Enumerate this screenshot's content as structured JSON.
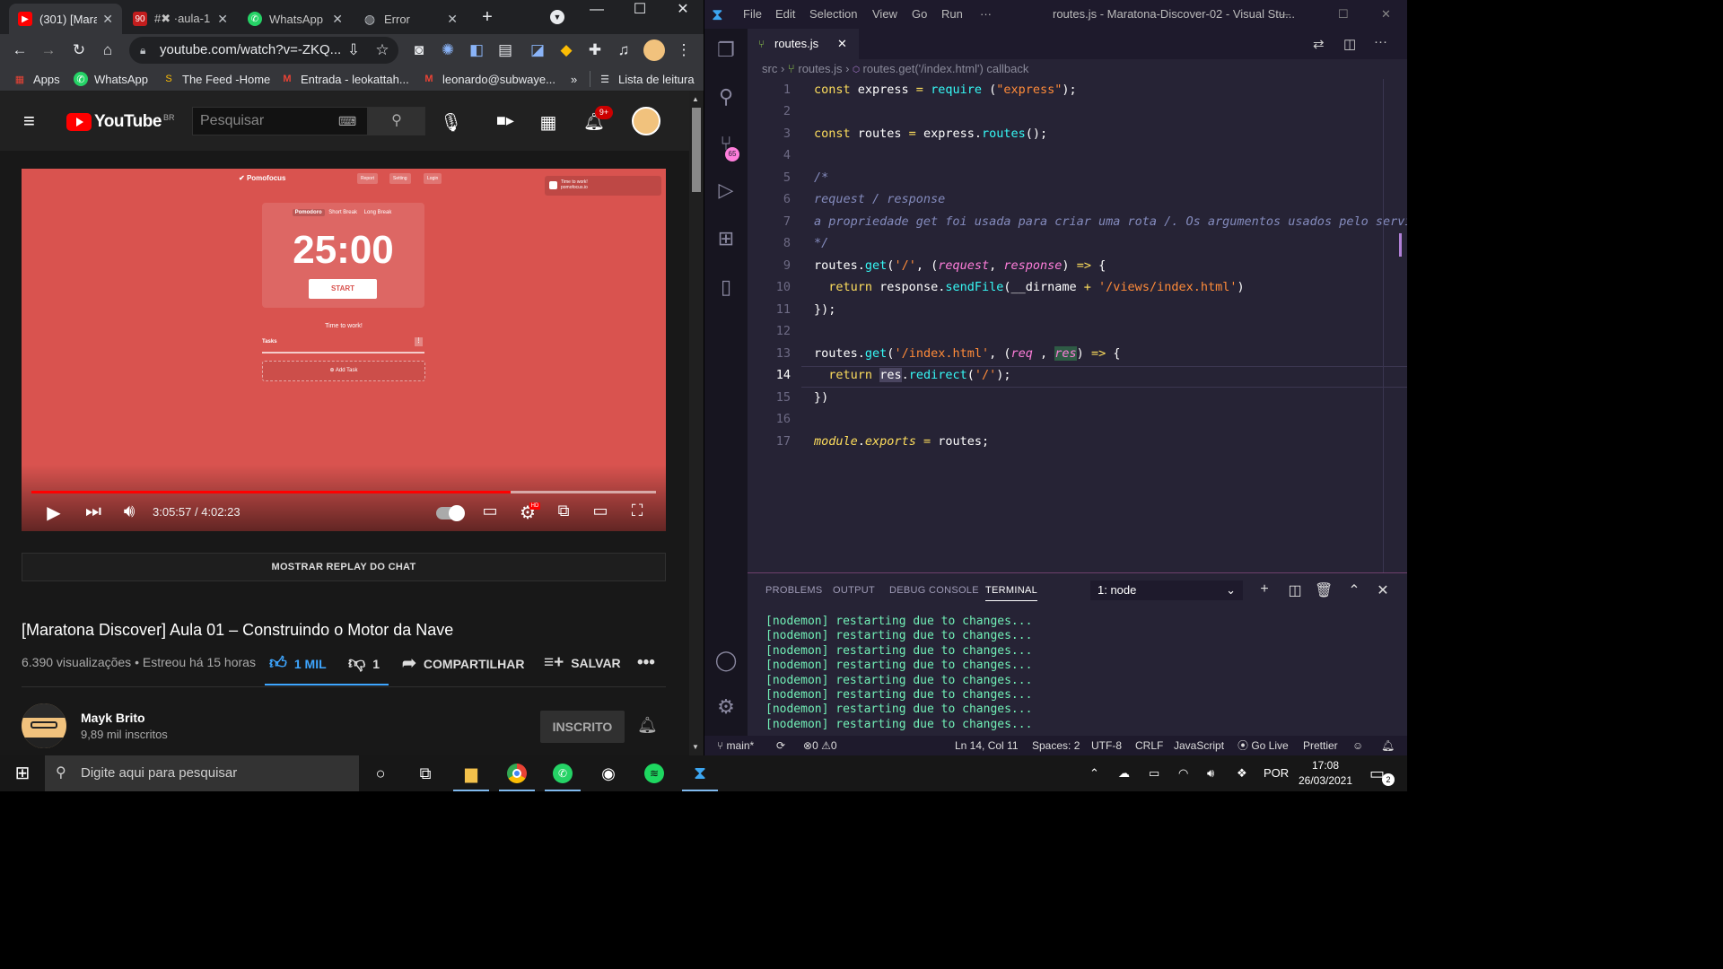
{
  "chrome": {
    "tabs": [
      {
        "title": "(301) [Mara",
        "favicon": "youtube-icon",
        "active": true
      },
      {
        "title": "#✖ ·aula-1",
        "favicon": "discord-icon",
        "active": false
      },
      {
        "title": "WhatsApp",
        "favicon": "whatsapp-icon",
        "active": false
      },
      {
        "title": "Error",
        "favicon": "globe-icon",
        "active": false
      }
    ],
    "new_tab": "+",
    "url": "youtube.com/watch?v=-ZKQ...",
    "bookmarks": [
      {
        "label": "Apps",
        "icon": "apps-grid-icon"
      },
      {
        "label": "WhatsApp",
        "icon": "whatsapp-icon"
      },
      {
        "label": "The Feed -Home",
        "icon": "feed-icon"
      },
      {
        "label": "Entrada - leokattah...",
        "icon": "gmail-icon"
      },
      {
        "label": "leonardo@subwaye...",
        "icon": "gmail-icon"
      }
    ],
    "bookmarks_overflow": "»",
    "reading_list": "Lista de leitura"
  },
  "youtube": {
    "logo_text": "YouTube",
    "country": "BR",
    "search_placeholder": "Pesquisar",
    "notification_badge": "9+",
    "video": {
      "app_logo": "Pomofocus",
      "top_buttons": [
        "Report",
        "Setting",
        "Login"
      ],
      "notification_title": "Time to work!",
      "notification_sub": "pomofocus.io",
      "modes": [
        "Pomodoro",
        "Short Break",
        "Long Break"
      ],
      "timer": "25:00",
      "start_label": "START",
      "status": "Time to work!",
      "tasks_label": "Tasks",
      "add_task_label": "Add Task",
      "current_time": "3:05:57",
      "duration": "4:02:23",
      "progress_fraction": 0.767
    },
    "chat_replay": "MOSTRAR REPLAY DO CHAT",
    "title": "[Maratona Discover] Aula 01 – Construindo o Motor da Nave",
    "meta": "6.390 visualizações • Estreou há 15 horas",
    "likes": "1 MIL",
    "dislikes": "1",
    "share": "COMPARTILHAR",
    "save": "SALVAR",
    "channel_name": "Mayk Brito",
    "channel_subs": "9,89 mil inscritos",
    "subscribe_label": "INSCRITO"
  },
  "vscode": {
    "menu": [
      "File",
      "Edit",
      "Selection",
      "View",
      "Go",
      "Run",
      "···"
    ],
    "window_title": "routes.js - Maratona-Discover-02 - Visual Stu...",
    "tab_name": "routes.js",
    "breadcrumb": [
      "src",
      "routes.js",
      "routes.get('/index.html') callback"
    ],
    "scm_badge": "65",
    "line_numbers": [
      "1",
      "2",
      "3",
      "4",
      "5",
      "6",
      "7",
      "8",
      "9",
      "10",
      "11",
      "12",
      "13",
      "14",
      "15",
      "16",
      "17"
    ],
    "comment_lines": [
      "/*",
      "request / response",
      "a propriedade get foi usada para criar uma rota /. Os argumentos usados pelo servidor",
      "*/"
    ],
    "panel_tabs": [
      "PROBLEMS",
      "OUTPUT",
      "DEBUG CONSOLE",
      "TERMINAL"
    ],
    "terminal_select": "1: node",
    "terminal_lines": [
      "[nodemon] restarting due to changes...",
      "[nodemon] restarting due to changes...",
      "[nodemon] restarting due to changes...",
      "[nodemon] restarting due to changes...",
      "[nodemon] restarting due to changes...",
      "[nodemon] restarting due to changes...",
      "[nodemon] restarting due to changes...",
      "[nodemon] restarting due to changes..."
    ],
    "status": {
      "branch": "main*",
      "errors": "0",
      "warnings": "0",
      "position": "Ln 14, Col 11",
      "spaces": "Spaces: 2",
      "encoding": "UTF-8",
      "eol": "CRLF",
      "language": "JavaScript",
      "golive": "Go Live",
      "prettier": "Prettier"
    }
  },
  "taskbar": {
    "search_placeholder": "Digite aqui para pesquisar",
    "language": "POR",
    "time": "17:08",
    "date": "26/03/2021",
    "notifications": "2"
  }
}
